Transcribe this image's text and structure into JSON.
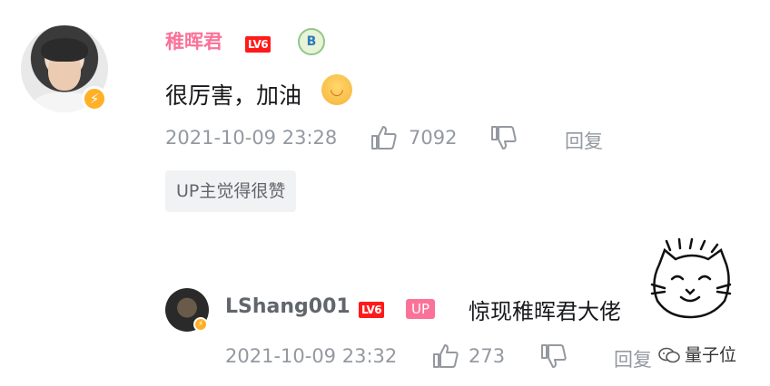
{
  "main_comment": {
    "username": "稚晖君",
    "level": "LV6",
    "content": "很厉害，加油",
    "time": "2021-10-09 23:28",
    "likes": "7092",
    "reply_label": "回复",
    "up_liked_tag": "UP主觉得很赞"
  },
  "sub_reply": {
    "username": "LShang001",
    "level": "LV6",
    "up_badge": "UP",
    "content": "惊现稚晖君大佬",
    "time": "2021-10-09 23:32",
    "likes": "273",
    "reply_label": "回复"
  },
  "medal_text": "B",
  "watermark": "量子位",
  "colors": {
    "username_pink": "#fb7299",
    "meta_gray": "#9499a0",
    "level_red": "#ff1a1a",
    "vip_gold": "#ffb027"
  }
}
